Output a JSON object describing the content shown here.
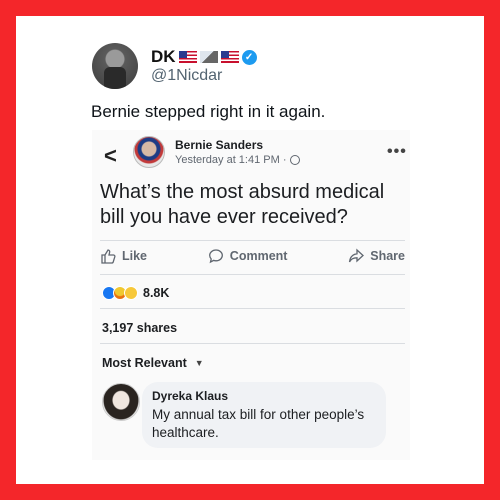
{
  "tweet": {
    "display_name": "DK",
    "handle": "@1Nicdar",
    "text": "Bernie stepped right in it again.",
    "name_icons": [
      "us-flag-icon",
      "mountain-icon",
      "us-flag-icon",
      "verified-icon"
    ]
  },
  "fb_post": {
    "author": "Bernie Sanders",
    "meta": "Yesterday at 1:41 PM ·",
    "question": "What’s the most absurd medical bill you have ever received?",
    "actions": {
      "like": "Like",
      "comment": "Comment",
      "share": "Share"
    },
    "reaction_count": "8.8K",
    "reaction_icons": [
      "like-reaction-icon",
      "angry-reaction-icon",
      "wow-reaction-icon"
    ],
    "shares": "3,197 shares",
    "sort_label": "Most Relevant",
    "comment": {
      "author": "Dyreka Klaus",
      "text": "My annual tax bill for other people’s healthcare."
    }
  },
  "colors": {
    "border": "#f4262a",
    "verified": "#1d9bf0",
    "fb_like": "#1877f2"
  }
}
